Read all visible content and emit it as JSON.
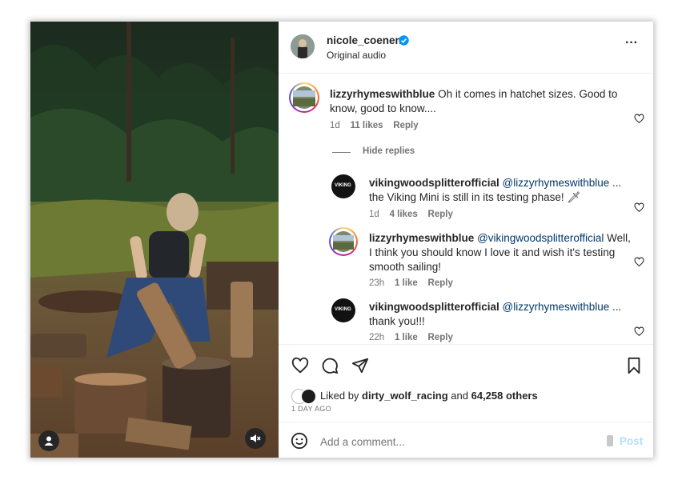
{
  "post": {
    "author": "nicole_coenen",
    "verified_icon": "verified-badge-icon",
    "audio": "Original audio",
    "more_label": "···"
  },
  "comments": [
    {
      "user": "lizzyrhymeswithblue",
      "mention": "",
      "text": "Oh it comes in hatchet sizes. Good to",
      "text2": "know, good to know....",
      "time": "1d",
      "likes": "11 likes",
      "reply": "Reply"
    }
  ],
  "hide_replies": "Hide replies",
  "replies": [
    {
      "user": "vikingwoodsplitterofficial",
      "mention": "@lizzyrhymeswithblue",
      "text_after": " ...",
      "text2": "the Viking Mini is still in its testing phase! 🗡",
      "time": "1d",
      "likes": "4 likes",
      "reply": "Reply"
    },
    {
      "user": "lizzyrhymeswithblue",
      "mention": "@vikingwoodsplitterofficial",
      "text_after": " Well,",
      "text2": "I think you should know I love it and wish it's testing",
      "text3": "smooth sailing!",
      "time": "23h",
      "likes": "1 like",
      "reply": "Reply"
    },
    {
      "user": "vikingwoodsplitterofficial",
      "mention": "@lizzyrhymeswithblue",
      "text_after": " ...",
      "text2": "thank you!!!",
      "time": "22h",
      "likes": "1 like",
      "reply": "Reply"
    }
  ],
  "likes_line": {
    "prefix": "Liked by ",
    "user": "dirty_wolf_racing",
    "middle": " and ",
    "count": "64,258 others"
  },
  "date": "1 DAY AGO",
  "add_comment": {
    "placeholder": "Add a comment...",
    "post_label": "Post"
  },
  "viking_logo_text": "VIKING",
  "colors": {
    "mention": "#00376b",
    "post_disabled": "#b2dffc",
    "muted": "#737373"
  }
}
